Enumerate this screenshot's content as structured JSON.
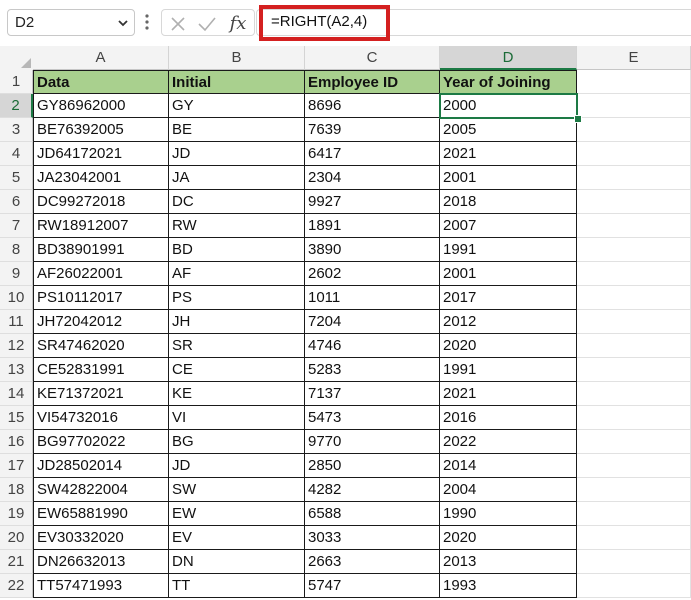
{
  "name_box": {
    "value": "D2"
  },
  "formula_bar": {
    "formula": "=RIGHT(A2,4)",
    "fx_label": "fx"
  },
  "columns": [
    "A",
    "B",
    "C",
    "D",
    "E"
  ],
  "active_column": "D",
  "active_row": "2",
  "header_row": {
    "row_number": "1",
    "cells": [
      "Data",
      "Initial",
      "Employee ID",
      "Year of Joining"
    ]
  },
  "rows": [
    {
      "num": "2",
      "data": "GY86962000",
      "initial": "GY",
      "id": "8696",
      "year": "2000"
    },
    {
      "num": "3",
      "data": "BE76392005",
      "initial": "BE",
      "id": "7639",
      "year": "2005"
    },
    {
      "num": "4",
      "data": "JD64172021",
      "initial": "JD",
      "id": "6417",
      "year": "2021"
    },
    {
      "num": "5",
      "data": "JA23042001",
      "initial": "JA",
      "id": "2304",
      "year": "2001"
    },
    {
      "num": "6",
      "data": "DC99272018",
      "initial": "DC",
      "id": "9927",
      "year": "2018"
    },
    {
      "num": "7",
      "data": "RW18912007",
      "initial": "RW",
      "id": "1891",
      "year": "2007"
    },
    {
      "num": "8",
      "data": "BD38901991",
      "initial": "BD",
      "id": "3890",
      "year": "1991"
    },
    {
      "num": "9",
      "data": "AF26022001",
      "initial": "AF",
      "id": "2602",
      "year": "2001"
    },
    {
      "num": "10",
      "data": "PS10112017",
      "initial": "PS",
      "id": "1011",
      "year": "2017"
    },
    {
      "num": "11",
      "data": "JH72042012",
      "initial": "JH",
      "id": "7204",
      "year": "2012"
    },
    {
      "num": "12",
      "data": "SR47462020",
      "initial": "SR",
      "id": "4746",
      "year": "2020"
    },
    {
      "num": "13",
      "data": "CE52831991",
      "initial": "CE",
      "id": "5283",
      "year": "1991"
    },
    {
      "num": "14",
      "data": "KE71372021",
      "initial": "KE",
      "id": "7137",
      "year": "2021"
    },
    {
      "num": "15",
      "data": "VI54732016",
      "initial": "VI",
      "id": "5473",
      "year": "2016"
    },
    {
      "num": "16",
      "data": "BG97702022",
      "initial": "BG",
      "id": "9770",
      "year": "2022"
    },
    {
      "num": "17",
      "data": "JD28502014",
      "initial": "JD",
      "id": "2850",
      "year": "2014"
    },
    {
      "num": "18",
      "data": "SW42822004",
      "initial": "SW",
      "id": "4282",
      "year": "2004"
    },
    {
      "num": "19",
      "data": "EW65881990",
      "initial": "EW",
      "id": "6588",
      "year": "1990"
    },
    {
      "num": "20",
      "data": "EV30332020",
      "initial": "EV",
      "id": "3033",
      "year": "2020"
    },
    {
      "num": "21",
      "data": "DN26632013",
      "initial": "DN",
      "id": "2663",
      "year": "2013"
    },
    {
      "num": "22",
      "data": "TT57471993",
      "initial": "TT",
      "id": "5747",
      "year": "1993"
    }
  ],
  "colors": {
    "header_fill": "#a9d08e",
    "selection": "#1d7a45",
    "formula_highlight": "#d42020"
  }
}
